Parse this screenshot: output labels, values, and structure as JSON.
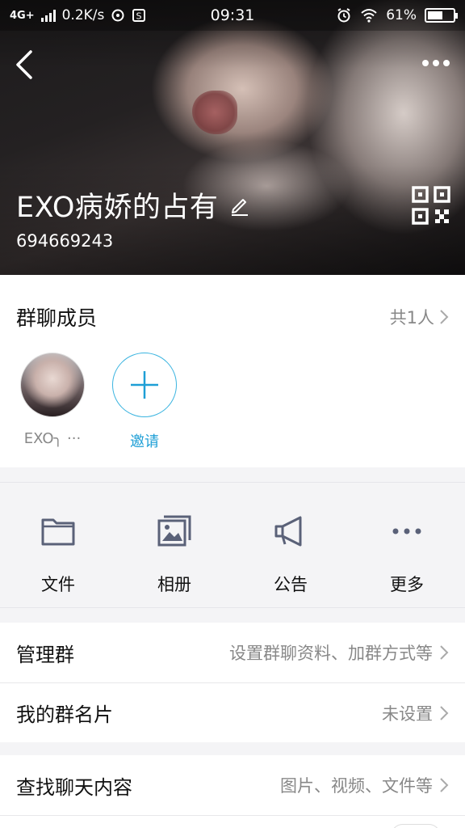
{
  "status_bar": {
    "network": "4G+",
    "speed": "0.2K/s",
    "time": "09:31",
    "battery": "61%",
    "battery_level": 0.61
  },
  "header": {
    "group_name": "EXO病娇的占有",
    "group_id": "694669243"
  },
  "members": {
    "title": "群聊成员",
    "count_label": "共1人",
    "list": [
      {
        "name": "EXO╮ ···"
      }
    ],
    "invite_label": "邀请"
  },
  "features": [
    {
      "label": "文件",
      "icon": "folder-icon"
    },
    {
      "label": "相册",
      "icon": "album-icon"
    },
    {
      "label": "公告",
      "icon": "megaphone-icon"
    },
    {
      "label": "更多",
      "icon": "more-dots-icon"
    }
  ],
  "settings": [
    {
      "title": "管理群",
      "value": "设置群聊资料、加群方式等"
    },
    {
      "title": "我的群名片",
      "value": "未设置"
    },
    {
      "title": "查找聊天内容",
      "value": "图片、视频、文件等"
    }
  ],
  "colors": {
    "accent": "#1e9fd6",
    "icon_gray": "#5a6178",
    "secondary_text": "#888888"
  }
}
